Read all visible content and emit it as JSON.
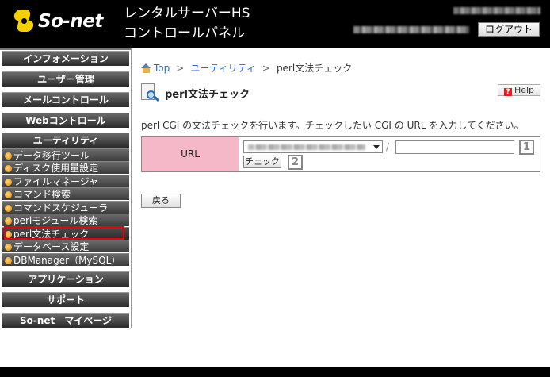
{
  "header": {
    "logo_text": "So-net",
    "title_line1": "レンタルサーバーHS",
    "title_line2": "コントロールパネル",
    "logout_label": "ログアウト"
  },
  "sidebar": {
    "heads": [
      {
        "label": "インフォメーション"
      },
      {
        "label": "ユーザー管理"
      },
      {
        "label": "メールコントロール"
      },
      {
        "label": "Webコントロール"
      },
      {
        "label": "ユーティリティ"
      }
    ],
    "utility_items": [
      {
        "label": "データ移行ツール"
      },
      {
        "label": "ディスク使用量設定"
      },
      {
        "label": "ファイルマネージャ"
      },
      {
        "label": "コマンド検索"
      },
      {
        "label": "コマンドスケジューラ"
      },
      {
        "label": "perlモジュール検索"
      },
      {
        "label": "perl文法チェック",
        "active": true
      },
      {
        "label": "データベース設定"
      },
      {
        "label": "DBManager（MySQL）"
      }
    ],
    "bottom_heads": [
      {
        "label": "アプリケーション"
      },
      {
        "label": "サポート"
      },
      {
        "label": "So-net　マイページ"
      }
    ]
  },
  "breadcrumb": {
    "items": [
      "Top",
      "ユーティリティ",
      "perl文法チェック"
    ],
    "separator": ">"
  },
  "page": {
    "title": "perl文法チェック",
    "help_label": "Help",
    "description": "perl CGI の文法チェックを行います。チェックしたい CGI の URL を入力してください。"
  },
  "form": {
    "url_label": "URL",
    "slash": "/",
    "path_value": "",
    "check_label": "チェック",
    "badge1": "1",
    "badge2": "2"
  },
  "actions": {
    "back_label": "戻る"
  },
  "colors": {
    "accent_highlight": "#e60012",
    "url_label_bg": "#f4b8c8",
    "link": "#3366cc"
  }
}
